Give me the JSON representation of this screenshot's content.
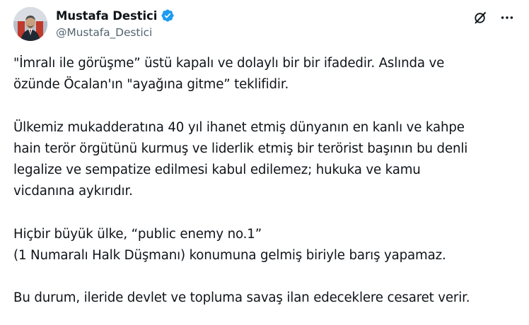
{
  "author": {
    "display_name": "Mustafa Destici",
    "handle": "@Mustafa_Destici",
    "verified_badge_color": "#1d9bf0"
  },
  "actions": {
    "grok_icon": "grok-icon",
    "more_icon": "more-horizontal-icon",
    "icon_color": "#0f1419"
  },
  "tweet": {
    "paragraphs": [
      {
        "lines": [
          "\"İmralı ile görüşme” üstü kapalı ve dolaylı bir bir ifadedir. Aslında ve",
          "özünde Öcalan'ın \"ayağına gitme” teklifidir."
        ]
      },
      {
        "lines": [
          "Ülkemiz mukadderatına 40 yıl ihanet etmiş dünyanın en kanlı ve kahpe",
          "hain terör örgütünü kurmuş ve liderlik etmiş bir terörist başının bu denli",
          "legalize ve sempatize edilmesi kabul edilemez; hukuka ve kamu",
          "vicdanına aykırıdır."
        ]
      },
      {
        "lines": [
          "Hiçbir büyük ülke, “public enemy no.1”",
          "(1 Numaralı Halk Düşmanı) konumuna gelmiş biriyle barış yapamaz."
        ]
      },
      {
        "lines": [
          "Bu durum, ileride devlet ve topluma savaş ilan edeceklere cesaret verir."
        ]
      }
    ]
  }
}
